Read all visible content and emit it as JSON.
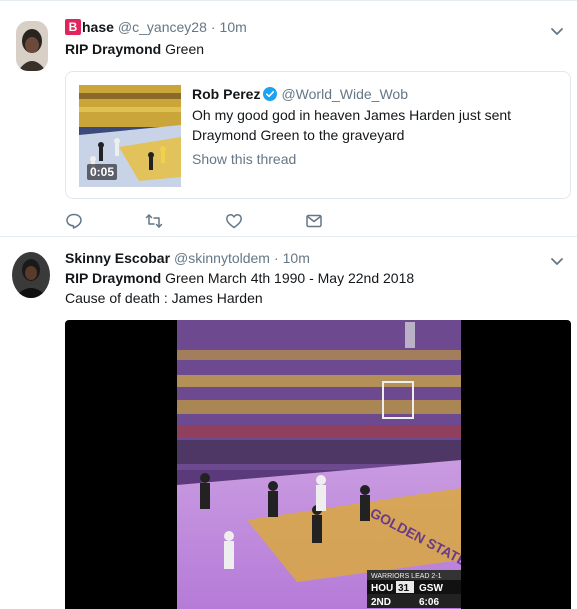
{
  "tweets": [
    {
      "badge": "B",
      "name": "hase",
      "handle": "@c_yancey28",
      "separator": "·",
      "time": "10m",
      "text_bold": "RIP Draymond",
      "text_rest": " Green",
      "quote": {
        "name": "Rob Perez",
        "handle": "@World_Wide_Wob",
        "text": "Oh my good god in heaven James Harden just sent Draymond Green to the graveyard",
        "show_thread": "Show this thread",
        "video_duration": "0:05"
      },
      "actions": [
        "reply-icon",
        "retweet-icon",
        "like-icon",
        "message-icon"
      ]
    },
    {
      "name": "Skinny Escobar",
      "handle": "@skinnytoldem",
      "separator": "·",
      "time": "10m",
      "text_bold": "RIP Draymond",
      "text_rest": " Green March 4th 1990 - May 22nd 2018",
      "text_line2": "Cause of death : James Harden",
      "scoreboard": {
        "banner": "WARRIORS LEAD 2-1",
        "team_away": "HOU",
        "score_away": "31",
        "team_home": "GSW",
        "quarter": "2ND",
        "clock": "6:06"
      },
      "court_text": "GOLDEN STATE"
    }
  ],
  "colors": {
    "accent": "#1da1f2",
    "secondary_text": "#657786",
    "border": "#e6ecf0",
    "badge": "#e0245e"
  }
}
